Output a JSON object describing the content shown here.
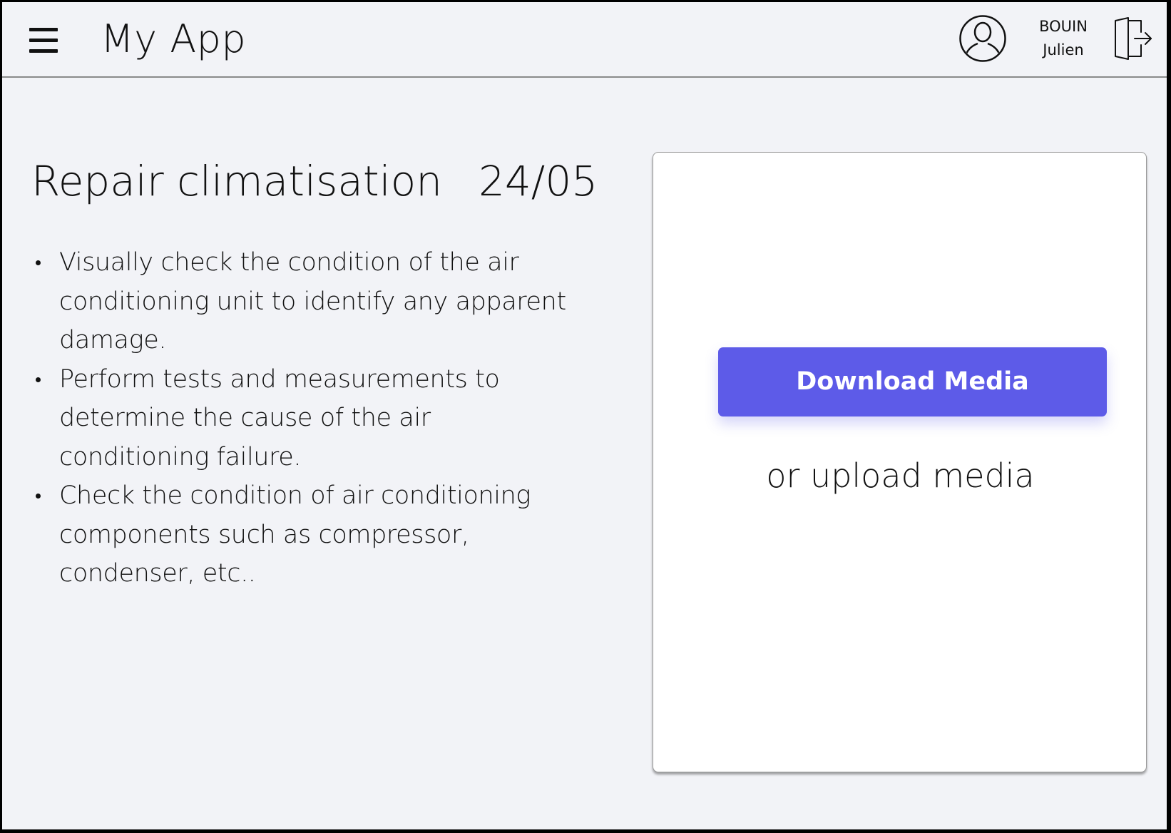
{
  "header": {
    "app_title": "My App",
    "user": {
      "last_name": "BOUIN",
      "first_name": "Julien"
    },
    "icons": {
      "menu": "hamburger-menu-icon",
      "avatar": "user-avatar-icon",
      "logout": "logout-door-icon"
    }
  },
  "task": {
    "title": "Repair climatisation",
    "date": "24/05",
    "steps": [
      "Visually check the condition of the air conditioning unit to identify any apparent damage.",
      "Perform tests and measurements to determine the cause of the air conditioning failure.",
      "Check the condition of air conditioning components such as compressor, condenser, etc.."
    ]
  },
  "media": {
    "download_label": "Download Media",
    "upload_label": "or upload media"
  },
  "colors": {
    "accent": "#5d5be8",
    "background": "#f2f3f7",
    "card": "#ffffff",
    "text": "#111111"
  }
}
